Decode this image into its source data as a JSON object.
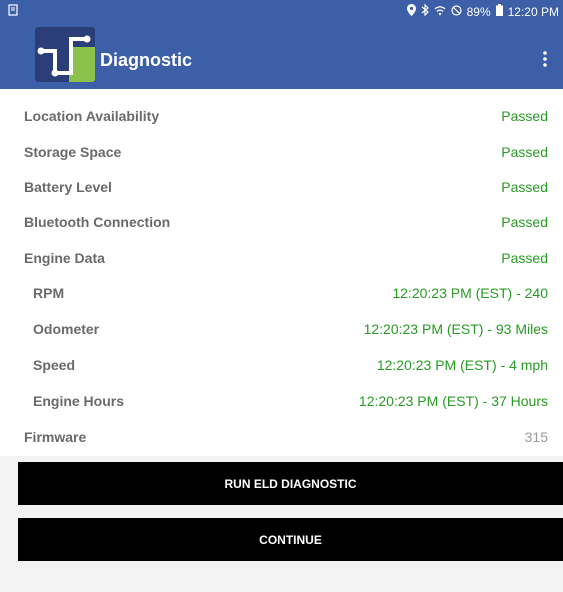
{
  "status_bar": {
    "battery": "89%",
    "time": "12:20 PM"
  },
  "app_bar": {
    "title": "Diagnostic"
  },
  "diagnostics": [
    {
      "label": "Location Availability",
      "value": "Passed"
    },
    {
      "label": "Storage Space",
      "value": "Passed"
    },
    {
      "label": "Battery Level",
      "value": "Passed"
    },
    {
      "label": "Bluetooth Connection",
      "value": "Passed"
    },
    {
      "label": "Engine Data",
      "value": "Passed"
    },
    {
      "label": "RPM",
      "value": "12:20:23 PM (EST) - 240"
    },
    {
      "label": "Odometer",
      "value": "12:20:23 PM (EST) - 93 Miles"
    },
    {
      "label": "Speed",
      "value": "12:20:23 PM (EST) - 4 mph"
    },
    {
      "label": "Engine Hours",
      "value": "12:20:23 PM (EST) - 37 Hours"
    },
    {
      "label": "Firmware",
      "value": "315"
    }
  ],
  "buttons": {
    "run_diagnostic": "RUN ELD DIAGNOSTIC",
    "continue": "CONTINUE"
  },
  "colors": {
    "app_bar": "#3d5fa8",
    "pass_text": "#279b23",
    "label_text": "#6a6a6a",
    "button_bg": "#000000"
  }
}
